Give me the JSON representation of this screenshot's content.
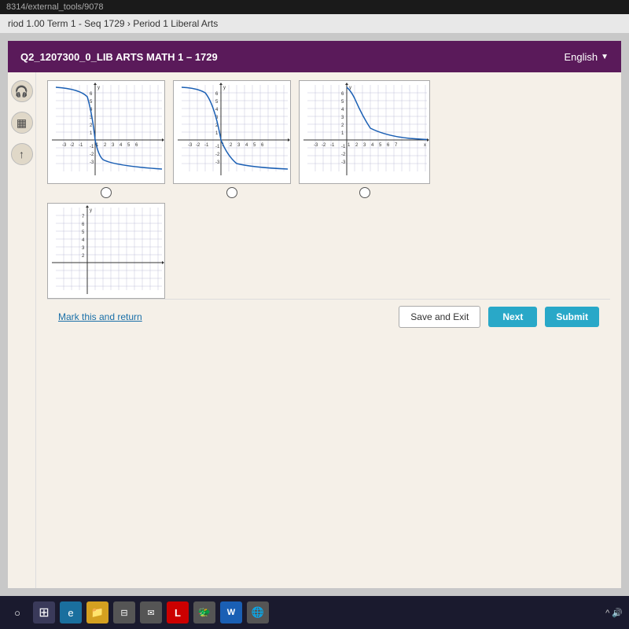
{
  "topbar": {
    "url": "8314/external_tools/9078"
  },
  "breadcrumb": {
    "text": "riod 1.00 Term 1 - Seq 1729 › Period 1 Liberal Arts"
  },
  "header": {
    "title": "Q2_1207300_0_LIB ARTS MATH 1 – 1729",
    "language": "English",
    "chevron": "▼"
  },
  "tools": {
    "headphone": "🎧",
    "calculator": "🖩",
    "arrow": "↑"
  },
  "actions": {
    "mark_return": "Mark this and return",
    "save_exit": "Save and Exit",
    "next": "Next",
    "submit": "Submit"
  },
  "taskbar": {
    "search_icon": "○",
    "icons": [
      "⊞",
      "e",
      "📁",
      "⊟",
      "✉",
      "L",
      "🐉",
      "W",
      "🌐"
    ],
    "system_tray": "^ 🔊"
  }
}
